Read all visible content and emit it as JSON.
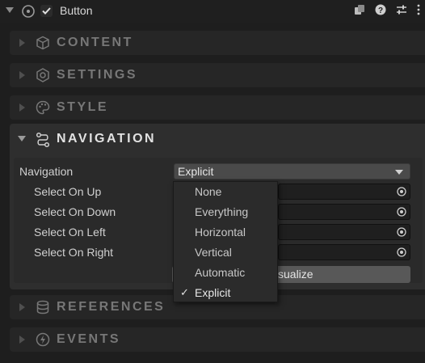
{
  "header": {
    "title": "Button",
    "enabled_checked": true,
    "icons": [
      "foldout-icon",
      "target-icon",
      "checkbox-icon",
      "copy-icon",
      "help-icon",
      "sliders-icon",
      "more-icon"
    ]
  },
  "sections": {
    "content": {
      "label": "CONTENT",
      "icon": "cube-icon"
    },
    "settings": {
      "label": "SETTINGS",
      "icon": "hexagon-gear-icon"
    },
    "style": {
      "label": "STYLE",
      "icon": "palette-icon"
    },
    "navigation": {
      "label": "NAVIGATION",
      "icon": "route-icon"
    },
    "references": {
      "label": "REFERENCES",
      "icon": "database-icon"
    },
    "events": {
      "label": "EVENTS",
      "icon": "bolt-icon"
    }
  },
  "navigation": {
    "mode_label": "Navigation",
    "mode_value": "Explicit",
    "select_on_up": "Select On Up",
    "select_on_down": "Select On Down",
    "select_on_left": "Select On Left",
    "select_on_right": "Select On Right",
    "visualize_label": "sualize"
  },
  "menu": {
    "items": [
      "None",
      "Everything",
      "Horizontal",
      "Vertical",
      "Automatic",
      "Explicit"
    ],
    "selected": "Explicit",
    "check_glyph": "✓"
  },
  "colors": {
    "background": "#1e1e1e",
    "section_collapsed": "#262626",
    "section_expanded": "#2e2e2e",
    "dropdown": "#4a4a4a",
    "button": "#585858"
  }
}
